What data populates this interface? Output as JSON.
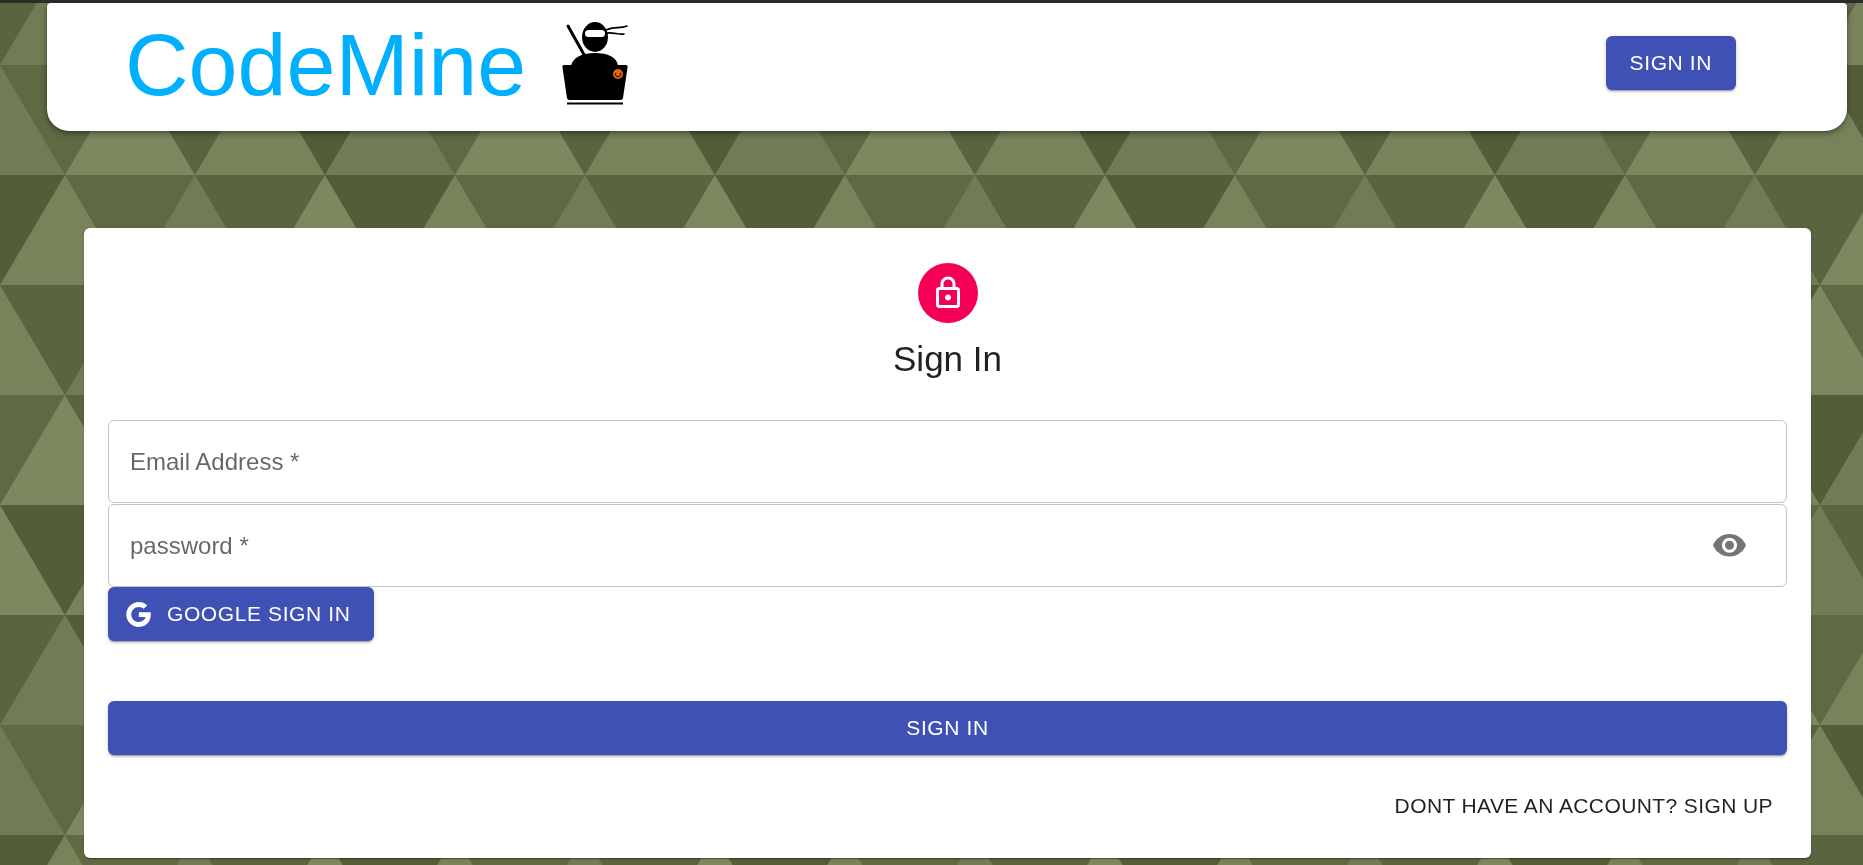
{
  "header": {
    "logo": "CodeMine",
    "sign_in_button": "SIGN IN"
  },
  "card": {
    "title": "Sign In",
    "fields": [
      {
        "kind": "email",
        "placeholder": "Email Address *"
      },
      {
        "kind": "password",
        "placeholder": "password *"
      }
    ],
    "google_button": "GOOGLE SIGN IN",
    "submit_button": "SIGN IN",
    "signup_link": "DONT HAVE AN ACCOUNT? SIGN UP"
  }
}
